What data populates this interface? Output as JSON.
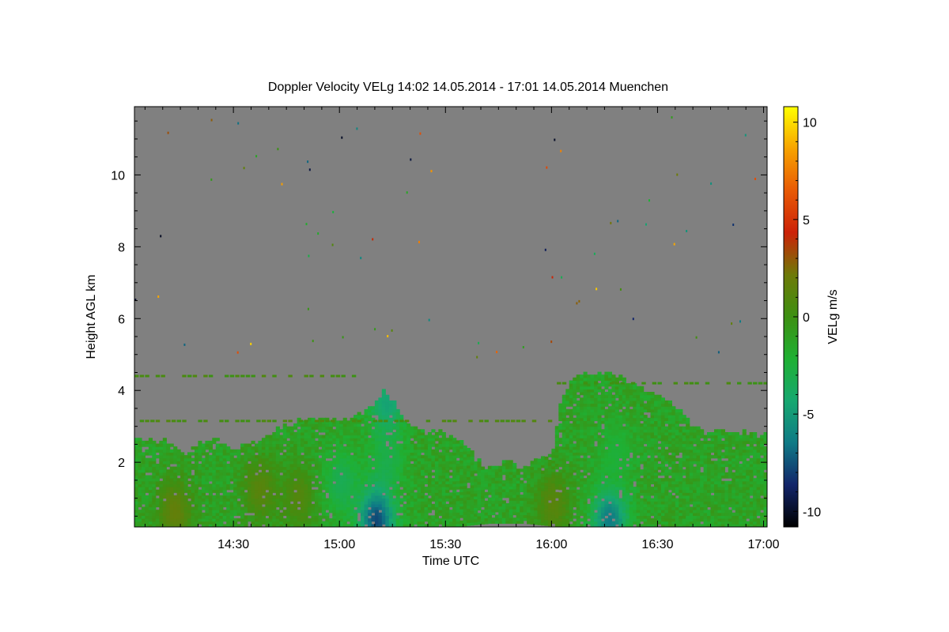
{
  "chart_data": {
    "type": "heatmap",
    "title": "Doppler Velocity VELg   14:02 14.05.2014 - 17:01 14.05.2014 Muenchen",
    "xlabel": "Time UTC",
    "ylabel": "Height AGL km",
    "colorbar_label": "VELg m/s",
    "x_range_minutes": [
      842,
      1021
    ],
    "ylim": [
      0.2,
      11.9
    ],
    "clim": [
      -10.8,
      10.8
    ],
    "x_ticks": [
      {
        "label": "14:30",
        "minutes": 870
      },
      {
        "label": "15:00",
        "minutes": 900
      },
      {
        "label": "15:30",
        "minutes": 930
      },
      {
        "label": "16:00",
        "minutes": 960
      },
      {
        "label": "16:30",
        "minutes": 990
      },
      {
        "label": "17:00",
        "minutes": 1020
      }
    ],
    "y_ticks": [
      {
        "label": "2",
        "value": 2
      },
      {
        "label": "4",
        "value": 4
      },
      {
        "label": "6",
        "value": 6
      },
      {
        "label": "8",
        "value": 8
      },
      {
        "label": "10",
        "value": 10
      }
    ],
    "colorbar_ticks": [
      {
        "label": "10",
        "value": 10
      },
      {
        "label": "5",
        "value": 5
      },
      {
        "label": "0",
        "value": 0
      },
      {
        "label": "-5",
        "value": -5
      },
      {
        "label": "-10",
        "value": -10
      }
    ],
    "background_color": "#808080",
    "colormap": [
      "#000000",
      "#12256a",
      "#0f7a86",
      "#17a870",
      "#1fb033",
      "#3d9012",
      "#6e7a08",
      "#cc2208",
      "#e85a05",
      "#f7a300",
      "#ffff00"
    ],
    "cloud_top_profile": [
      [
        842,
        2.6
      ],
      [
        848,
        2.6
      ],
      [
        852,
        2.5
      ],
      [
        856,
        2.2
      ],
      [
        860,
        2.5
      ],
      [
        865,
        2.6
      ],
      [
        869,
        2.3
      ],
      [
        873,
        2.5
      ],
      [
        878,
        2.6
      ],
      [
        882,
        2.9
      ],
      [
        886,
        3.0
      ],
      [
        890,
        3.2
      ],
      [
        894,
        3.2
      ],
      [
        898,
        3.1
      ],
      [
        902,
        3.2
      ],
      [
        906,
        3.3
      ],
      [
        909,
        3.6
      ],
      [
        912,
        3.9
      ],
      [
        915,
        3.6
      ],
      [
        919,
        3.0
      ],
      [
        924,
        2.8
      ],
      [
        929,
        2.8
      ],
      [
        934,
        2.5
      ],
      [
        937,
        2.3
      ],
      [
        940,
        1.8
      ],
      [
        944,
        1.8
      ],
      [
        947,
        2.0
      ],
      [
        951,
        1.8
      ],
      [
        954,
        2.0
      ],
      [
        957,
        2.1
      ],
      [
        960,
        2.3
      ],
      [
        962,
        3.6
      ],
      [
        965,
        4.3
      ],
      [
        970,
        4.5
      ],
      [
        975,
        4.4
      ],
      [
        980,
        4.3
      ],
      [
        984,
        4.1
      ],
      [
        988,
        3.9
      ],
      [
        992,
        3.7
      ],
      [
        996,
        3.4
      ],
      [
        999,
        3.0
      ],
      [
        1003,
        2.8
      ],
      [
        1008,
        2.8
      ],
      [
        1014,
        2.8
      ],
      [
        1017,
        2.7
      ],
      [
        1021,
        2.8
      ]
    ],
    "cloud_base_profile": [
      [
        842,
        0.2
      ],
      [
        852,
        0.2
      ],
      [
        862,
        0.2
      ],
      [
        872,
        0.2
      ],
      [
        882,
        0.2
      ],
      [
        892,
        0.2
      ],
      [
        902,
        0.2
      ],
      [
        912,
        0.2
      ],
      [
        922,
        0.2
      ],
      [
        932,
        0.2
      ],
      [
        942,
        0.3
      ],
      [
        952,
        0.3
      ],
      [
        962,
        0.2
      ],
      [
        972,
        0.2
      ],
      [
        982,
        0.2
      ],
      [
        992,
        0.2
      ],
      [
        1002,
        0.2
      ],
      [
        1012,
        0.2
      ],
      [
        1021,
        0.2
      ]
    ],
    "updraft_cores": [
      {
        "t": 877,
        "h": 1.2,
        "v": 1.5
      },
      {
        "t": 853,
        "h": 0.6,
        "v": 2.0
      },
      {
        "t": 888,
        "h": 1.0,
        "v": 1.2
      },
      {
        "t": 900,
        "h": 1.4,
        "v": -3.5
      },
      {
        "t": 913,
        "h": 2.0,
        "v": -3.0
      },
      {
        "t": 913,
        "h": 3.6,
        "v": -5.0
      },
      {
        "t": 976,
        "h": 0.4,
        "v": -7.0
      },
      {
        "t": 910,
        "h": 0.35,
        "v": -8.5
      },
      {
        "t": 960,
        "h": 0.8,
        "v": 1.5
      },
      {
        "t": 978,
        "h": 2.2,
        "v": -2.5
      }
    ],
    "clutter_layers": [
      {
        "h": 4.4,
        "t_start": 842,
        "t_end": 905,
        "v": 0.3
      },
      {
        "h": 3.15,
        "t_start": 842,
        "t_end": 960,
        "v": 0.5
      },
      {
        "h": 4.2,
        "t_start": 960,
        "t_end": 1021,
        "v": 0.2
      }
    ]
  }
}
